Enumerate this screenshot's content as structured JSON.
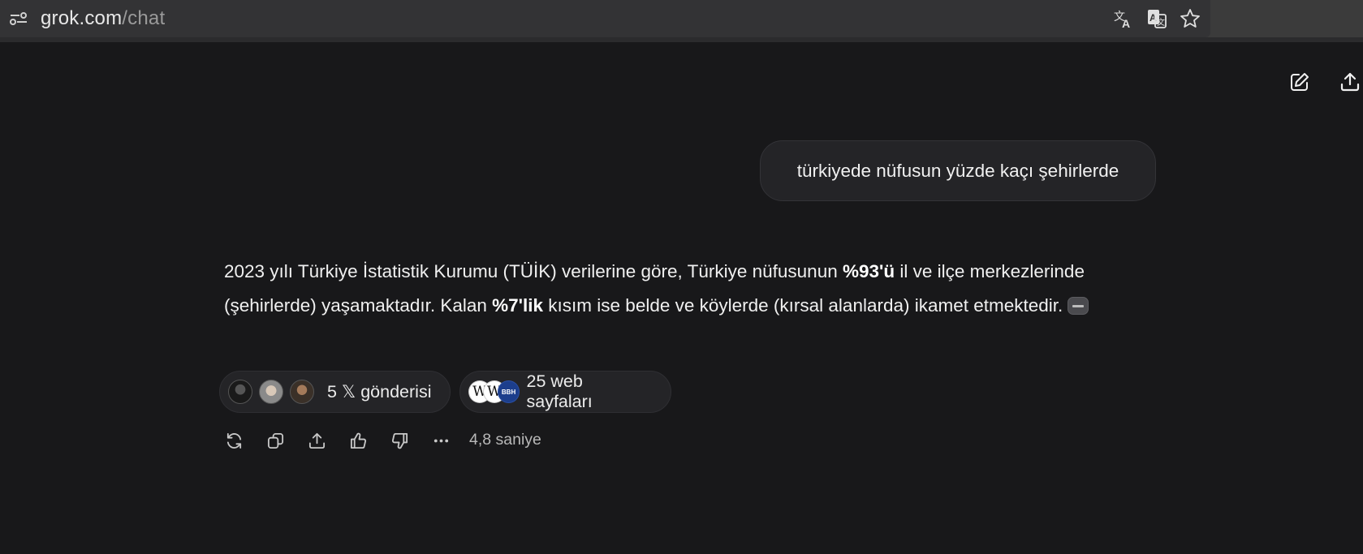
{
  "browser": {
    "url_domain": "grok.com",
    "url_path": "/chat",
    "icons": [
      "tune-icon",
      "translate-icon",
      "page-translate-icon",
      "bookmark-star-icon"
    ]
  },
  "header_actions": [
    "edit-icon",
    "share-upload-icon"
  ],
  "conversation": {
    "user_message": "türkiyede nüfusun yüzde kaçı şehirlerde",
    "answer": {
      "line1_pre": "2023 yılı Türkiye İstatistik Kurumu (TÜİK) verilerine göre, Türkiye nüfusunun ",
      "bold1": "%93'ü",
      "line1_post": " il ve ilçe merkezlerinde (şehirlerde) yaşamaktadır. Kalan ",
      "bold2": "%7'lik",
      "line2_post": " kısım ise belde ve köylerde (kırsal alanlarda) ikamet etmektedir."
    },
    "sources": {
      "x_posts_label": "5 𝕏 gönderisi",
      "web_pages_label": "25 web sayfaları",
      "favicon_w1": "W",
      "favicon_w2": "W",
      "favicon_news": "BBH"
    },
    "elapsed": "4,8 saniye"
  },
  "colors": {
    "background": "#18181a",
    "bubble": "#242427",
    "chip": "#242427",
    "text": "#ececec"
  }
}
